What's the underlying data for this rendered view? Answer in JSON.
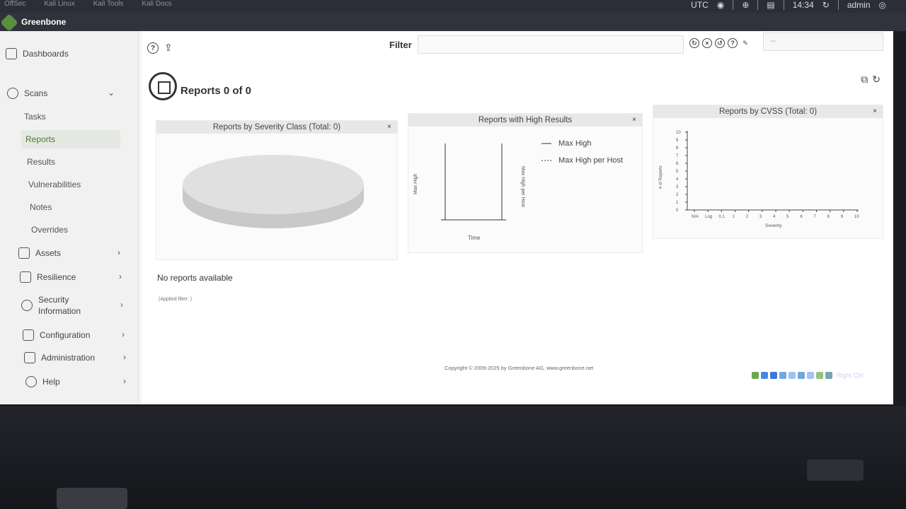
{
  "topbar": {
    "tabs": [
      "OffSec",
      "Kali Linux",
      "Kali Tools",
      "Kali Docs"
    ],
    "timezone": "UTC",
    "time": "14:34",
    "user": "admin"
  },
  "app": {
    "title": "Greenbone"
  },
  "sidebar": {
    "items": [
      {
        "label": "Dashboards"
      },
      {
        "label": "Scans"
      },
      {
        "label": "Tasks"
      },
      {
        "label": "Reports"
      },
      {
        "label": "Results"
      },
      {
        "label": "Vulnerabilities"
      },
      {
        "label": "Notes"
      },
      {
        "label": "Overrides"
      },
      {
        "label": "Assets"
      },
      {
        "label": "Resilience"
      },
      {
        "label": "Security Information"
      },
      {
        "label": "Configuration"
      },
      {
        "label": "Administration"
      },
      {
        "label": "Help"
      }
    ]
  },
  "filter": {
    "label": "Filter",
    "value": "",
    "select_value": "--"
  },
  "page": {
    "title": "Reports 0 of 0",
    "empty_text": "No reports available",
    "applied_filter": "(Applied filter: )"
  },
  "panels": {
    "severity": {
      "title": "Reports by Severity Class (Total: 0)"
    },
    "high": {
      "title": "Reports with High Results",
      "ylabel_left": "Max High",
      "ylabel_right": "Max High per Host",
      "xlabel": "Time",
      "legend": [
        "Max High",
        "Max High per Host"
      ]
    },
    "cvss": {
      "title": "Reports by CVSS (Total: 0)",
      "ylabel": "# of Reports",
      "xlabel": "Severity",
      "y_ticks": [
        "10",
        "9",
        "8",
        "7",
        "6",
        "5",
        "4",
        "3",
        "2",
        "1",
        "0"
      ],
      "x_ticks": [
        "N/A",
        "Log",
        "0.1",
        "1",
        "2",
        "3",
        "4",
        "5",
        "6",
        "7",
        "8",
        "9",
        "10"
      ]
    }
  },
  "footer": {
    "copyright": "Copyright © 2009-2025 by Greenbone AG, www.greenbone.net"
  },
  "tray": {
    "host_key": "Right Ctrl"
  },
  "colors": {
    "brand": "#5b8f3e",
    "active_text": "#4a7b2f"
  }
}
